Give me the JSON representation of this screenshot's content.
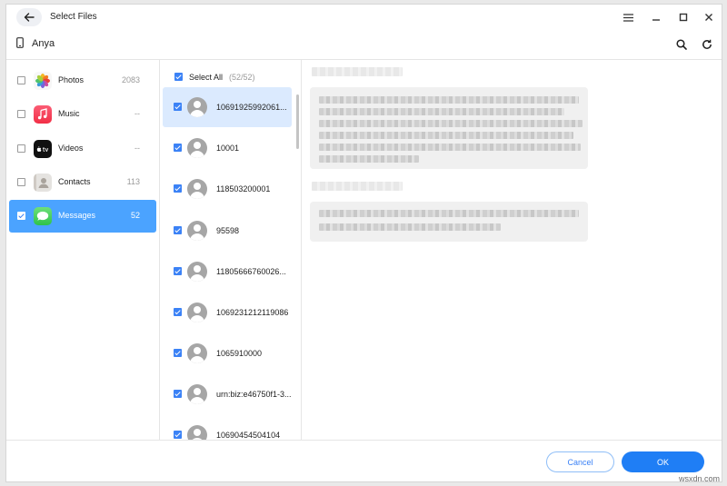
{
  "window": {
    "title": "Select Files"
  },
  "device": {
    "name": "Anya"
  },
  "categories": [
    {
      "label": "Photos",
      "count": "2083",
      "checked": false
    },
    {
      "label": "Music",
      "count": "--",
      "checked": false
    },
    {
      "label": "Videos",
      "count": "--",
      "checked": false
    },
    {
      "label": "Contacts",
      "count": "113",
      "checked": false
    },
    {
      "label": "Messages",
      "count": "52",
      "checked": true
    }
  ],
  "select_all": {
    "label": "Select All",
    "count": "(52/52)"
  },
  "conversations": [
    {
      "name": "10691925992061..."
    },
    {
      "name": "10001"
    },
    {
      "name": "118503200001"
    },
    {
      "name": "95598"
    },
    {
      "name": "11805666760026..."
    },
    {
      "name": "1069231212119086"
    },
    {
      "name": "1065910000"
    },
    {
      "name": "urn:biz:e46750f1-3..."
    },
    {
      "name": "10690454504104"
    }
  ],
  "footer": {
    "cancel_label": "Cancel",
    "ok_label": "OK"
  },
  "watermark": "wsxdn.com",
  "colors": {
    "accent": "#1f7ef5",
    "sidebar_active": "#4ba3ff",
    "conversation_active": "#dbeafe"
  }
}
